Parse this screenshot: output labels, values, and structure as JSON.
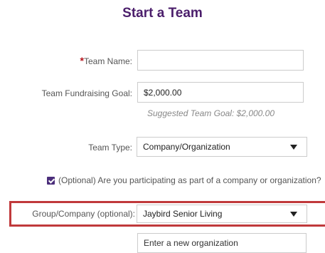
{
  "page_title": "Start a Team",
  "team_name": {
    "required_marker": "*",
    "label": "Team Name:",
    "value": ""
  },
  "goal": {
    "label": "Team Fundraising Goal:",
    "value": "$2,000.00",
    "hint": "Suggested Team Goal: $2,000.00"
  },
  "team_type": {
    "label": "Team Type:",
    "selected": "Company/Organization"
  },
  "company_check": {
    "checked": true,
    "label": "(Optional) Are you participating as part of a company or organization?"
  },
  "group_company": {
    "label": "Group/Company (optional):",
    "selected": "Jaybird Senior Living"
  },
  "new_org": {
    "value": "Enter a new organization"
  },
  "colors": {
    "title": "#4b1e6b",
    "required": "#b5121b",
    "highlight": "#c0393b",
    "checkbox": "#4b2e7b"
  },
  "icons": {
    "dropdown": "caret-down-icon",
    "check": "checkmark-icon"
  }
}
